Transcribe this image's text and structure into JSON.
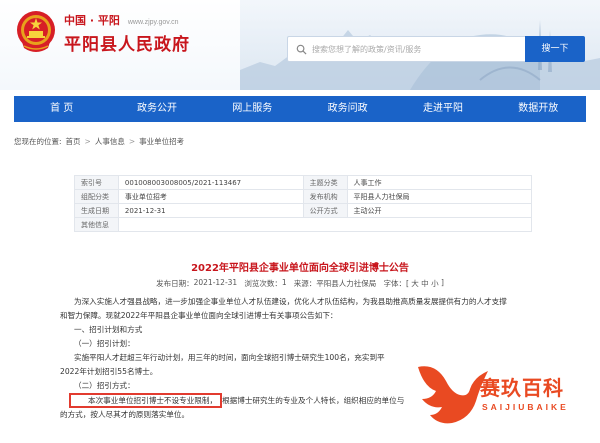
{
  "header": {
    "place": "中国 · 平阳",
    "domain": "www.zjpy.gov.cn",
    "site_name": "平阳县人民政府",
    "search_placeholder": "搜索您想了解的政策/资讯/服务",
    "search_button": "搜一下"
  },
  "nav": [
    "首 页",
    "政务公开",
    "网上服务",
    "政务问政",
    "走进平阳",
    "数据开放"
  ],
  "breadcrumb": {
    "prefix": "您现在的位置:",
    "items": [
      "首页",
      "人事信息",
      "事业单位招考"
    ],
    "sep": ">"
  },
  "meta": {
    "rows": [
      {
        "k1": "索引号",
        "v1": "001008003008005/2021-113467",
        "k2": "主题分类",
        "v2": "人事工作"
      },
      {
        "k1": "组配分类",
        "v1": "事业单位招考",
        "k2": "发布机构",
        "v2": "平阳县人力社保局"
      },
      {
        "k1": "生成日期",
        "v1": "2021-12-31",
        "k2": "公开方式",
        "v2": "主动公开"
      },
      {
        "k1": "其他信息",
        "v1": "",
        "k2": "",
        "v2": ""
      }
    ]
  },
  "article": {
    "title": "2022年平阳县企事业单位面向全球引进博士公告",
    "date_label": "发布日期：",
    "date": "2021-12-31",
    "views_label": "浏览次数：",
    "views": "1",
    "source_label": "来源：",
    "source": "平阳县人力社保局",
    "font_label": "字体：[",
    "font_large": "大",
    "font_medium": "中",
    "font_small": "小",
    "font_end": "]",
    "paragraphs": {
      "p1": "为深入实施人才强县战略，进一步加强企事业单位人才队伍建设，优化人才队伍结构，为我县助推高质量发展提供有力的人才支撑",
      "p1b": "和智力保障。现就2022年平阳县企事业单位面向全球引进博士有关事项公告如下：",
      "s1": "一、招引计划和方式",
      "s1a": "（一）招引计划：",
      "p2": "实施平阳人才赶超三年行动计划，用三年的时间，面向全球招引博士研究生100名，充实到平",
      "p2b": "2022年计划招引55名博士。",
      "s1b": "（二）招引方式：",
      "p3_highlight": "本次事业单位招引博士不设专业限制，",
      "p3_rest": "根据博士研究生的专业及个人特长，组织相应的单位与",
      "p3b": "的方式，按人尽其才的原则落实单位。"
    }
  },
  "watermark": {
    "text": "赛玖百科",
    "sub": "SAIJIUBAIKE"
  },
  "colors": {
    "brand_red": "#c8161d",
    "nav_blue": "#1a63c8",
    "highlight_red": "#e23b2f",
    "watermark_orange": "#e94a22"
  }
}
